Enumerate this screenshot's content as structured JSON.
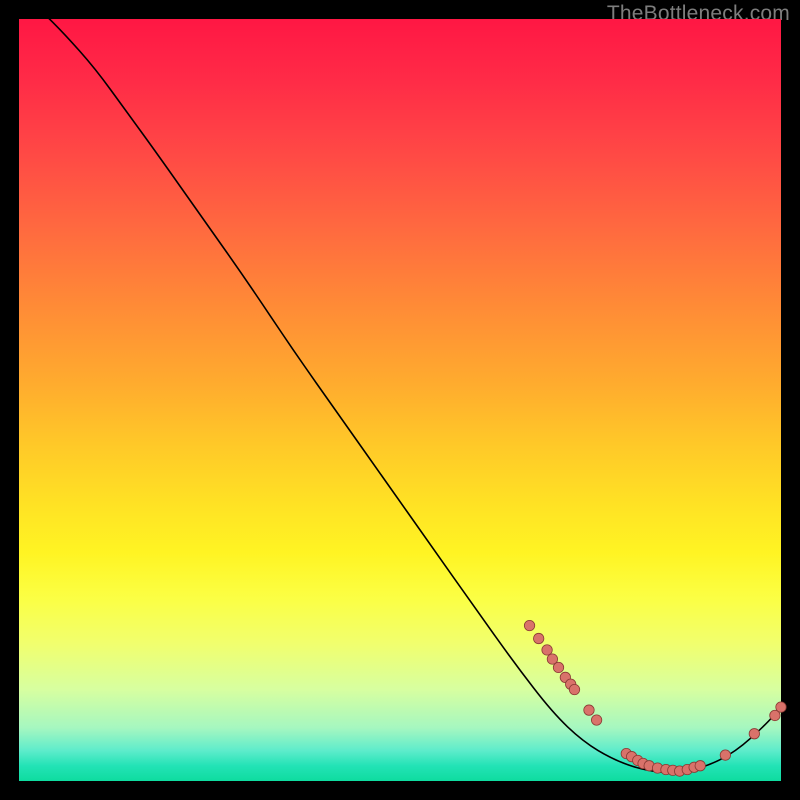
{
  "watermark": "TheBottleneck.com",
  "colors": {
    "background": "#000000",
    "curve": "#000000",
    "dot_fill": "#d9726a",
    "dot_stroke": "#8a3a34"
  },
  "chart_data": {
    "type": "line",
    "title": "",
    "xlabel": "",
    "ylabel": "",
    "xlim": [
      0,
      100
    ],
    "ylim": [
      0,
      100
    ],
    "grid": false,
    "legend": null,
    "curve": [
      {
        "x": 3.0,
        "y": 101.0
      },
      {
        "x": 6.0,
        "y": 98.0
      },
      {
        "x": 10.0,
        "y": 93.5
      },
      {
        "x": 14.0,
        "y": 88.0
      },
      {
        "x": 18.0,
        "y": 82.5
      },
      {
        "x": 24.0,
        "y": 74.0
      },
      {
        "x": 30.0,
        "y": 65.5
      },
      {
        "x": 36.0,
        "y": 56.5
      },
      {
        "x": 42.0,
        "y": 48.0
      },
      {
        "x": 48.0,
        "y": 39.5
      },
      {
        "x": 54.0,
        "y": 31.0
      },
      {
        "x": 60.0,
        "y": 22.5
      },
      {
        "x": 65.0,
        "y": 15.5
      },
      {
        "x": 70.0,
        "y": 9.0
      },
      {
        "x": 74.0,
        "y": 5.2
      },
      {
        "x": 78.0,
        "y": 2.8
      },
      {
        "x": 82.0,
        "y": 1.4
      },
      {
        "x": 86.0,
        "y": 1.0
      },
      {
        "x": 90.0,
        "y": 1.8
      },
      {
        "x": 94.0,
        "y": 3.8
      },
      {
        "x": 98.0,
        "y": 7.4
      },
      {
        "x": 100.0,
        "y": 9.7
      }
    ],
    "dots": [
      {
        "x": 67.0,
        "y": 20.4
      },
      {
        "x": 68.2,
        "y": 18.7
      },
      {
        "x": 69.3,
        "y": 17.2
      },
      {
        "x": 70.0,
        "y": 16.0
      },
      {
        "x": 70.8,
        "y": 14.9
      },
      {
        "x": 71.7,
        "y": 13.6
      },
      {
        "x": 72.4,
        "y": 12.7
      },
      {
        "x": 72.9,
        "y": 12.0
      },
      {
        "x": 74.8,
        "y": 9.3
      },
      {
        "x": 75.8,
        "y": 8.0
      },
      {
        "x": 79.7,
        "y": 3.6
      },
      {
        "x": 80.4,
        "y": 3.2
      },
      {
        "x": 81.2,
        "y": 2.7
      },
      {
        "x": 81.9,
        "y": 2.3
      },
      {
        "x": 82.7,
        "y": 2.0
      },
      {
        "x": 83.8,
        "y": 1.7
      },
      {
        "x": 84.9,
        "y": 1.5
      },
      {
        "x": 85.8,
        "y": 1.4
      },
      {
        "x": 86.7,
        "y": 1.3
      },
      {
        "x": 87.7,
        "y": 1.5
      },
      {
        "x": 88.6,
        "y": 1.8
      },
      {
        "x": 89.4,
        "y": 2.0
      },
      {
        "x": 92.7,
        "y": 3.4
      },
      {
        "x": 96.5,
        "y": 6.2
      },
      {
        "x": 99.2,
        "y": 8.6
      },
      {
        "x": 100.0,
        "y": 9.7
      }
    ]
  }
}
